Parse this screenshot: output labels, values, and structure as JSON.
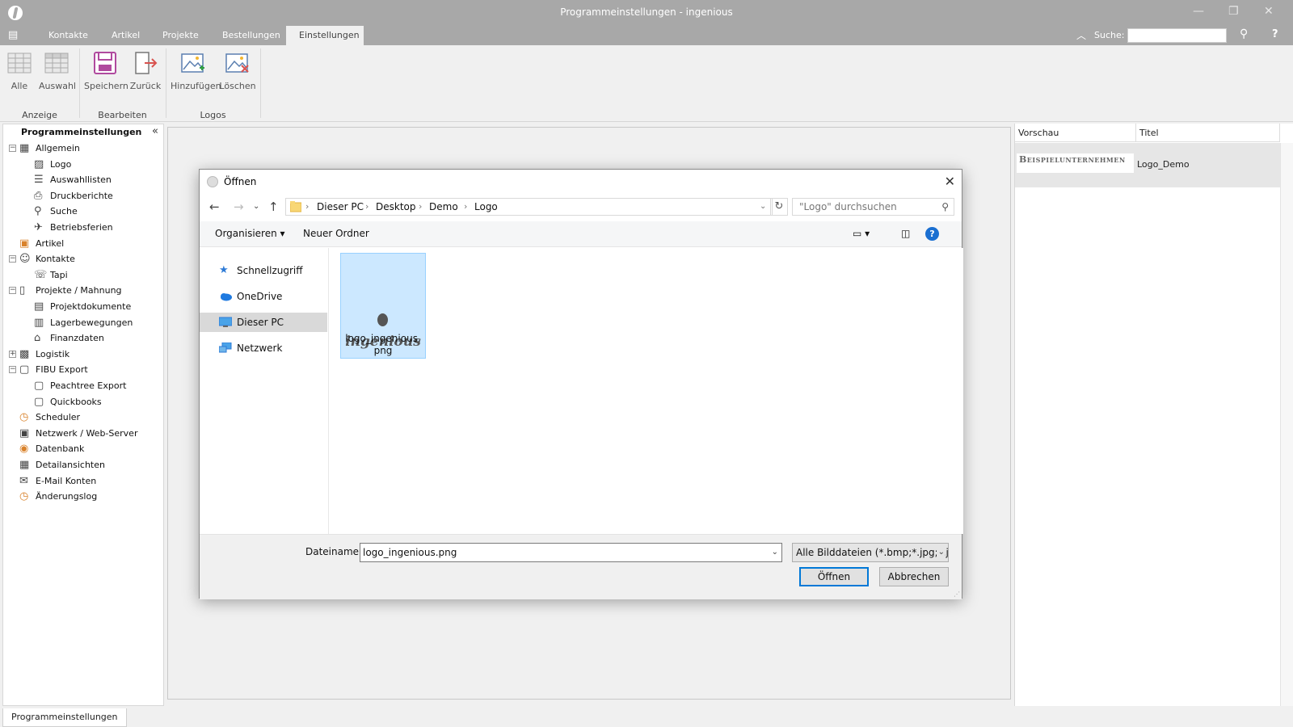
{
  "window": {
    "title": "Programmeinstellungen - ingenious"
  },
  "menu": {
    "tabs": [
      "Kontakte",
      "Artikel",
      "Projekte",
      "Bestellungen",
      "Einstellungen"
    ],
    "active_tab": "Einstellungen",
    "search_label": "Suche:",
    "search_value": ""
  },
  "ribbon": {
    "buttons": [
      "Alle",
      "Auswahl",
      "Speichern",
      "Zurück",
      "Hinzufügen",
      "Löschen"
    ],
    "groups": [
      "Anzeige",
      "Bearbeiten",
      "Logos"
    ]
  },
  "left_panel": {
    "title": "Programmeinstellungen",
    "tree": [
      {
        "label": "Allgemein",
        "icon": "settings-card-icon",
        "level": 0,
        "expander": "−"
      },
      {
        "label": "Logo",
        "icon": "image-icon",
        "level": 1,
        "selected": true
      },
      {
        "label": "Auswahllisten",
        "icon": "list-icon",
        "level": 1
      },
      {
        "label": "Druckberichte",
        "icon": "printer-icon",
        "level": 1
      },
      {
        "label": "Suche",
        "icon": "binoculars-icon",
        "level": 1
      },
      {
        "label": "Betriebsferien",
        "icon": "plane-icon",
        "level": 1
      },
      {
        "label": "Artikel",
        "icon": "article-icon",
        "level": 0
      },
      {
        "label": "Kontakte",
        "icon": "person-icon",
        "level": 0,
        "expander": "−"
      },
      {
        "label": "Tapi",
        "icon": "phone-icon",
        "level": 1
      },
      {
        "label": "Projekte / Mahnung",
        "icon": "document-icon",
        "level": 0,
        "expander": "−"
      },
      {
        "label": "Projektdokumente",
        "icon": "document-list-icon",
        "level": 1
      },
      {
        "label": "Lagerbewegungen",
        "icon": "warehouse-icon",
        "level": 1
      },
      {
        "label": "Finanzdaten",
        "icon": "bank-icon",
        "level": 1
      },
      {
        "label": "Logistik",
        "icon": "truck-icon",
        "level": 0,
        "expander": "+"
      },
      {
        "label": "FIBU Export",
        "icon": "export-icon",
        "level": 0,
        "expander": "−"
      },
      {
        "label": "Peachtree Export",
        "icon": "export-icon",
        "level": 1
      },
      {
        "label": "Quickbooks",
        "icon": "export-icon",
        "level": 1
      },
      {
        "label": "Scheduler",
        "icon": "clock-icon",
        "level": 0
      },
      {
        "label": "Netzwerk / Web-Server",
        "icon": "network-icon",
        "level": 0
      },
      {
        "label": "Datenbank",
        "icon": "database-icon",
        "level": 0
      },
      {
        "label": "Detailansichten",
        "icon": "grid-icon",
        "level": 0
      },
      {
        "label": "E-Mail Konten",
        "icon": "mail-icon",
        "level": 0
      },
      {
        "label": "Änderungslog",
        "icon": "log-icon",
        "level": 0
      }
    ]
  },
  "right_panel": {
    "columns": [
      "Vorschau",
      "Titel"
    ],
    "rows": [
      {
        "preview": "Beispielunternehmen",
        "title": "Logo_Demo"
      }
    ]
  },
  "bottom_tab": "Programmeinstellungen",
  "dialog": {
    "title": "Öffnen",
    "breadcrumb": [
      "Dieser PC",
      "Desktop",
      "Demo",
      "Logo"
    ],
    "search_placeholder": "\"Logo\" durchsuchen",
    "toolbar": {
      "organize": "Organisieren",
      "new_folder": "Neuer Ordner"
    },
    "nav": [
      "Schnellzugriff",
      "OneDrive",
      "Dieser PC",
      "Netzwerk"
    ],
    "nav_selected": "Dieser PC",
    "files": [
      {
        "name": "logo_ingenious.png",
        "thumb_text": "ingenious"
      }
    ],
    "filename_label": "Dateiname:",
    "filename_value": "logo_ingenious.png",
    "filter_value": "Alle Bilddateien (*.bmp;*.jpg;*.j",
    "open_button": "Öffnen",
    "cancel_button": "Abbrechen"
  }
}
